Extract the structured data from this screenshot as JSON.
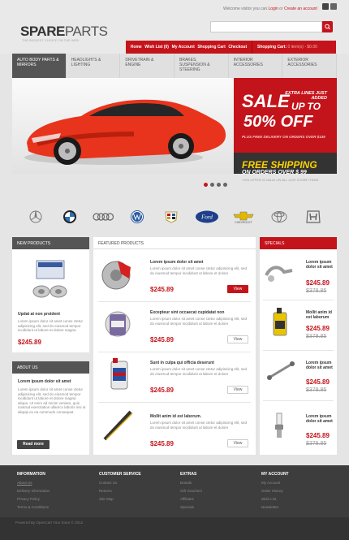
{
  "header": {
    "logo_bold": "SPARE",
    "logo_light": "PARTS",
    "tagline": "THE BIGGEST CHOICE ON THE WEB",
    "welcome_text": "Welcome visitor you can",
    "login": "Login",
    "or": "or",
    "create_account": "Create an account",
    "search_placeholder": ""
  },
  "topnav": {
    "items": [
      "Home",
      "Wish List (0)",
      "My Account",
      "Shopping Cart",
      "Checkout"
    ]
  },
  "cart": {
    "label": "Shopping Cart:",
    "summary": "0 item(s) - $0.00"
  },
  "categories": [
    {
      "label": "Auto Body Parts & Mirrors",
      "active": true
    },
    {
      "label": "Headlights & Lighting",
      "active": false
    },
    {
      "label": "Drivetrain & Engine",
      "active": false
    },
    {
      "label": "Brakes, Suspension & Steering",
      "active": false
    },
    {
      "label": "Interior Accessories",
      "active": false
    },
    {
      "label": "Exterior Accessories",
      "active": false
    }
  ],
  "banner": {
    "sale": "SALE",
    "extra": "EXTRA LINES JUST ADDED",
    "upto": "UP TO",
    "off": "50% OFF",
    "fine": "PLUS FREE DELIVERY ON ORDERS OVER $149",
    "ship_1": "FREE SHIPPING",
    "ship_2": "ON ORDERS OVER $ 99",
    "ship_3": "THIS OFFER IS VALID ON ALL OUR STORE ITEMS"
  },
  "brands": [
    "mercedes-icon",
    "bmw-icon",
    "audi-icon",
    "volkswagen-icon",
    "cadillac-icon",
    "ford-icon",
    "chevrolet-icon",
    "toyota-icon",
    "honda-icon"
  ],
  "brand_texts": {
    "ford": "Ford",
    "chevrolet": "CHEVROLET"
  },
  "new_products": {
    "title": "New Products",
    "item_title": "Updat at non proident",
    "item_desc": "Lorem ipsum dolor sit amet conse ctetur adipisicing elit, sed do eiusmod tempor incididunt ut labore et dolore magna",
    "item_price": "$245.89"
  },
  "about": {
    "title": "About Us",
    "heading": "Lorem ipsum dolor sit amet",
    "text": "Lorem ipsum dolor sit amet conse ctetur adipisicing elit, sed do eiusmod tempor incididunt ut labore et dolore magna aliqua. Ut enim ad minim veniam, quis nostrud exercitation ullamco laboris nisi ut aliquip ex ea commodo consequat.",
    "button": "Read more"
  },
  "featured": {
    "title": "Featured Products",
    "items": [
      {
        "title": "Lorem ipsum dolor sit amet",
        "desc": "Lorem ipsum dolor sit amet conse ctetur adipisicing elit, sed do eiusmod tempor incididunt ut labore et dolore",
        "price": "$245.89",
        "button": "View",
        "red": true
      },
      {
        "title": "Excepteur sint occaecat cupidatat non",
        "desc": "Lorem ipsum dolor sit amet conse ctetur adipisicing elit, sed do eiusmod tempor incididunt ut labore et dolore",
        "price": "$245.89",
        "button": "View",
        "red": false
      },
      {
        "title": "Sunt in culpa qui officia deserunt",
        "desc": "Lorem ipsum dolor sit amet conse ctetur adipisicing elit, sed do eiusmod tempor incididunt ut labore et dolore",
        "price": "$245.89",
        "button": "View",
        "red": false
      },
      {
        "title": "Mollit anim id est laborum.",
        "desc": "Lorem ipsum dolor sit amet conse ctetur adipisicing elit, sed do eiusmod tempor incididunt ut labore et dolore",
        "price": "$245.89",
        "button": "View",
        "red": false
      }
    ]
  },
  "specials": {
    "title": "Specials",
    "items": [
      {
        "title": "Lorem ipsum dolor sit amet",
        "price": "$245.89",
        "old": "$378.85"
      },
      {
        "title": "Mollit anim id est laborum",
        "price": "$245.89",
        "old": "$378.85"
      },
      {
        "title": "Lorem ipsum dolor sit amet",
        "price": "$245.89",
        "old": "$378.85"
      },
      {
        "title": "Lorem ipsum dolor sit amet",
        "price": "$245.89",
        "old": "$378.85"
      }
    ]
  },
  "footer": {
    "columns": [
      {
        "title": "Information",
        "links": [
          "About Us",
          "Delivery Information",
          "Privacy Policy",
          "Terms & Conditions"
        ]
      },
      {
        "title": "Customer Service",
        "links": [
          "Contact Us",
          "Returns",
          "Site Map"
        ]
      },
      {
        "title": "Extras",
        "links": [
          "Brands",
          "Gift Vouchers",
          "Affiliates",
          "Specials"
        ]
      },
      {
        "title": "My Account",
        "links": [
          "My Account",
          "Order History",
          "Wish List",
          "Newsletter"
        ]
      }
    ],
    "copyright": "Powered By OpenCart Your Store © 2012"
  },
  "colors": {
    "accent": "#c4141b",
    "dark": "#3d3d3d",
    "bg": "#e5e5e5"
  }
}
